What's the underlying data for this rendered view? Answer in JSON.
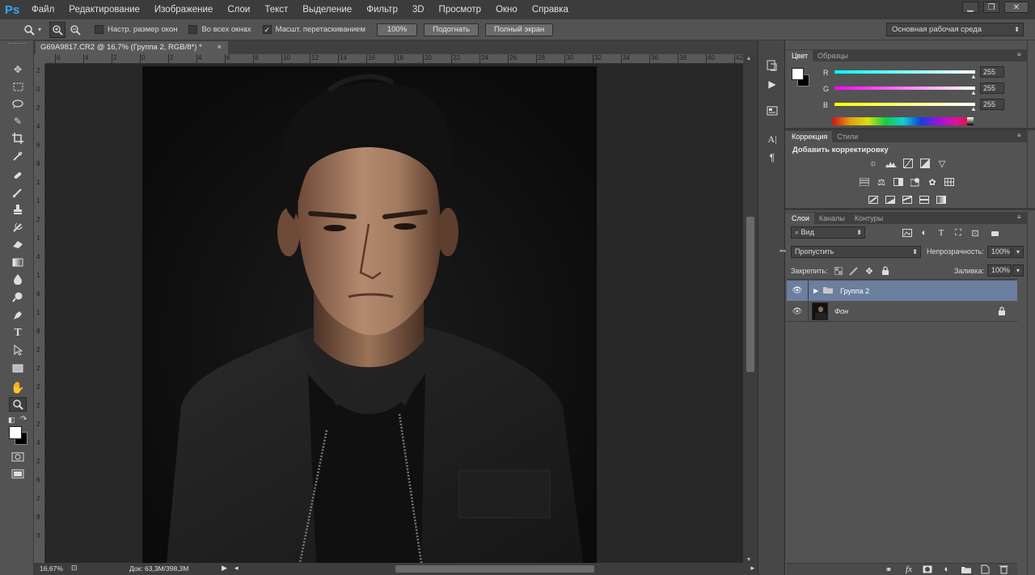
{
  "app": {
    "logo": "Ps"
  },
  "menu": [
    "Файл",
    "Редактирование",
    "Изображение",
    "Слои",
    "Текст",
    "Выделение",
    "Фильтр",
    "3D",
    "Просмотр",
    "Окно",
    "Справка"
  ],
  "window_controls": {
    "minimize": "▁",
    "restore": "❐",
    "close": "✕"
  },
  "options_bar": {
    "fit_window": "Настр. размер окон",
    "all_windows": "Во всех окнах",
    "scrubby": "Масшт. перетаскиванием",
    "zoom_100": "100%",
    "fit": "Подогнать",
    "fullscreen": "Полный экран",
    "workspace": "Основная рабочая среда"
  },
  "document": {
    "tab_title": "G69A9817.CR2 @ 16,7% (Группа 2, RGB/8*) *",
    "close": "×"
  },
  "status": {
    "zoom": "16,67%",
    "doc": "Док: 63,3M/398,3M"
  },
  "ruler_h": [
    "6",
    "4",
    "2",
    "0",
    "2",
    "4",
    "6",
    "8",
    "10",
    "12",
    "14",
    "16",
    "18",
    "20",
    "22",
    "24",
    "26",
    "28",
    "30",
    "32",
    "34",
    "36",
    "38",
    "40",
    "42"
  ],
  "ruler_v": [
    "2",
    "0",
    "2",
    "4",
    "6",
    "8",
    "1",
    "1",
    "2",
    "1",
    "4",
    "1",
    "6",
    "1",
    "8",
    "2",
    "2",
    "2",
    "2",
    "2",
    "4",
    "2",
    "6",
    "2",
    "8",
    "3"
  ],
  "color_panel": {
    "tabs": [
      "Цвет",
      "Образцы"
    ],
    "channels": [
      {
        "label": "R",
        "value": "255",
        "gradient": "linear-gradient(90deg,#00ffff,#ffffff)"
      },
      {
        "label": "G",
        "value": "255",
        "gradient": "linear-gradient(90deg,#ff00ff,#ffffff)"
      },
      {
        "label": "B",
        "value": "255",
        "gradient": "linear-gradient(90deg,#ffff00,#ffffff)"
      }
    ]
  },
  "adjustments_panel": {
    "tabs": [
      "Коррекция",
      "Стили"
    ],
    "title": "Добавить корректировку"
  },
  "layers_panel": {
    "tabs": [
      "Слои",
      "Каналы",
      "Контуры"
    ],
    "filter": "Вид",
    "blend_mode": "Пропустить",
    "opacity_label": "Непрозрачность:",
    "opacity": "100%",
    "lock_label": "Закрепить:",
    "fill_label": "Заливка:",
    "fill": "100%",
    "layers": [
      {
        "name": "Группа 2",
        "type": "group",
        "selected": true
      },
      {
        "name": "Фон",
        "type": "image",
        "locked": true
      }
    ]
  },
  "colors": {
    "accent": "#31a8ff",
    "selected_layer": "#6b7f9e"
  }
}
